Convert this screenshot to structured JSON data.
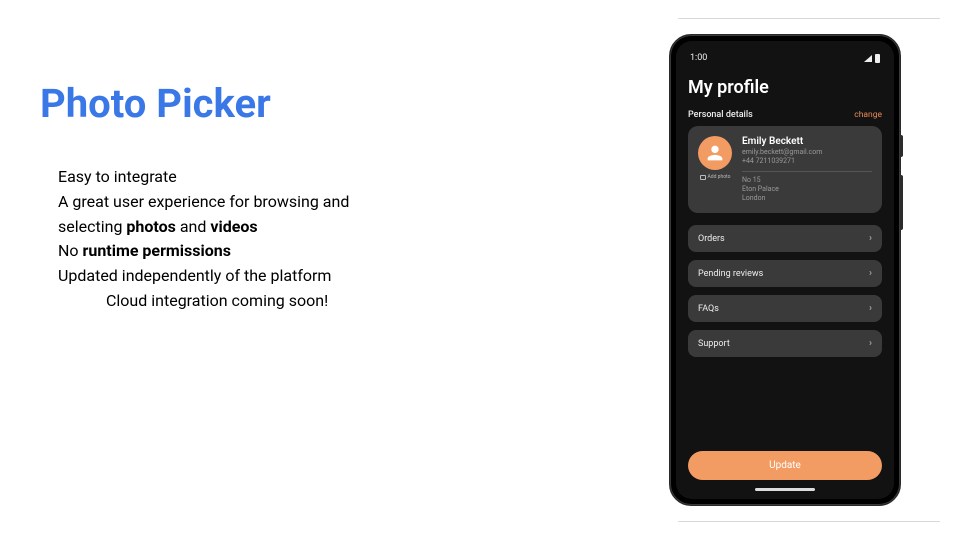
{
  "slide": {
    "title": "Photo Picker",
    "bullets": {
      "l1": "Easy to integrate",
      "l2a": "A great user experience for browsing and",
      "l2b_pre": "selecting ",
      "l2b_b1": "photos",
      "l2b_mid": " and ",
      "l2b_b2": "videos",
      "l3_pre": "No ",
      "l3_b": "runtime permissions",
      "l4": "Updated independently of the platform",
      "l5": "Cloud integration coming soon!"
    }
  },
  "phone": {
    "status_time": "1:00",
    "page_title": "My profile",
    "section_label": "Personal details",
    "change_label": "change",
    "profile": {
      "name": "Emily Beckett",
      "email": "emily.beckett@gmail.com",
      "phone": "+44 7211039271",
      "addr1": "No 15",
      "addr2": "Eton Palace",
      "addr3": "London",
      "add_photo": "Add photo"
    },
    "menu": {
      "orders": "Orders",
      "pending": "Pending reviews",
      "faqs": "FAQs",
      "support": "Support"
    },
    "update": "Update"
  }
}
